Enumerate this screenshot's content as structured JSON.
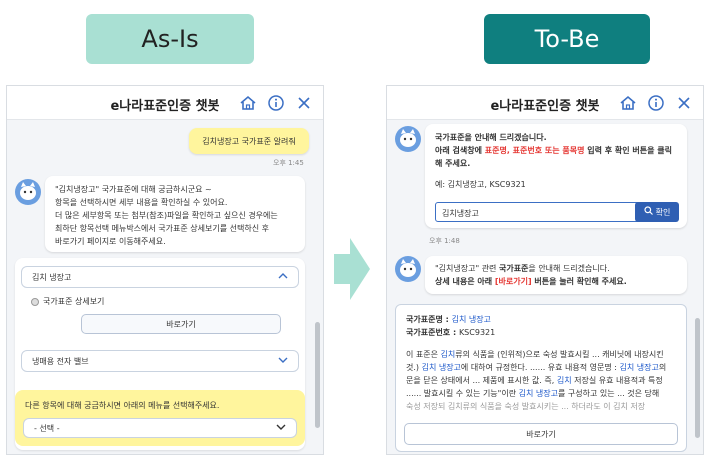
{
  "labels": {
    "asis": "As-Is",
    "tobe": "To-Be"
  },
  "asis": {
    "title": "e나라표준인증 챗봇",
    "user_msg": "김치냉장고 국가표준 알려줘",
    "user_time": "오후 1:45",
    "bot_msg_line1": "\"김치냉장고\" 국가표준에 대해 궁금하시군요 ~",
    "bot_msg_line2": "항목을 선택하시면 세부 내용을 확인하실 수 있어요.",
    "bot_msg_line3": "더 많은 세부항목 또는 첨부(참조)파일을 확인하고 싶으신 경우에는",
    "bot_msg_line4": "최하단 항목선택 메뉴박스에서 국가표준 상세보기를 선택하신 후",
    "bot_msg_line5": "바로가기 페이지로 이동해주세요.",
    "select1_value": "김치 냉장고",
    "radio_label": "국가표준 상세보기",
    "goto_button": "바로가기",
    "select2_value": "냉매용 전자 밸브",
    "notice": "다른 항목에 대해 궁금하시면 아래의 메뉴를 선택해주세요.",
    "select3_value": "- 선택 -"
  },
  "tobe": {
    "title": "e나라표준인증 챗봇",
    "bot1_line1": "국가표준을 안내해 드리겠습니다.",
    "bot1_line2_a": "아래 검색창에 ",
    "bot1_line2_red": "표준명, 표준번호 또는 품목명",
    "bot1_line2_b": " 입력 후 확인 버튼을 클릭",
    "bot1_line3": "해 주세요.",
    "bot1_example": "예: 김치냉장고, KSC9321",
    "search_value": "김치냉장고",
    "search_button": "확인",
    "time": "오후 1:48",
    "bot2_line1_a": "\"김치냉장고\" 관련 ",
    "bot2_line1_bold": "국가표준",
    "bot2_line1_b": "을 안내해 드리겠습니다.",
    "bot2_line2_a": "상세 내용은 아래 ",
    "bot2_line2_red": "[바로가기]",
    "bot2_line2_b": " 버튼을 눌러 확인해 주세요.",
    "card_name_label": "국가표준명 : ",
    "card_name_value": "김치 냉장고",
    "card_no_label": "국가표준번호 : ",
    "card_no_value": "KSC9321",
    "body1_a": "이 표준은 ",
    "body1_hl": "김치",
    "body1_b": "류의 식품을 (인위적)으로 숙성 발효시킬 ... 캐비닛에 내장시킨",
    "body2_a": "것.) ",
    "body2_hl": "김치 냉장고",
    "body2_b": "에 대하여 규정한다. ...... 유효 내용적 영문명 : ",
    "body2_hl2": "김치 냉장고",
    "body2_c": "의",
    "body3_a": "문을 닫은 상태에서 ... 제품에 표시한 값. 즉, ",
    "body3_hl": "김치",
    "body3_b": " 저장실 유효 내용적과 특정",
    "body4_a": "...... 발효시킬 수 있는 기능\"이란 ",
    "body4_hl": "김치 냉장고",
    "body4_b": "를 구성하고 있는 ... 것은 당해",
    "body5": "숙성 저장되 김치류의 식품을 숙성 발효시키는 ... 하더라도 이 김치 저장",
    "goto_button": "바로가기"
  }
}
